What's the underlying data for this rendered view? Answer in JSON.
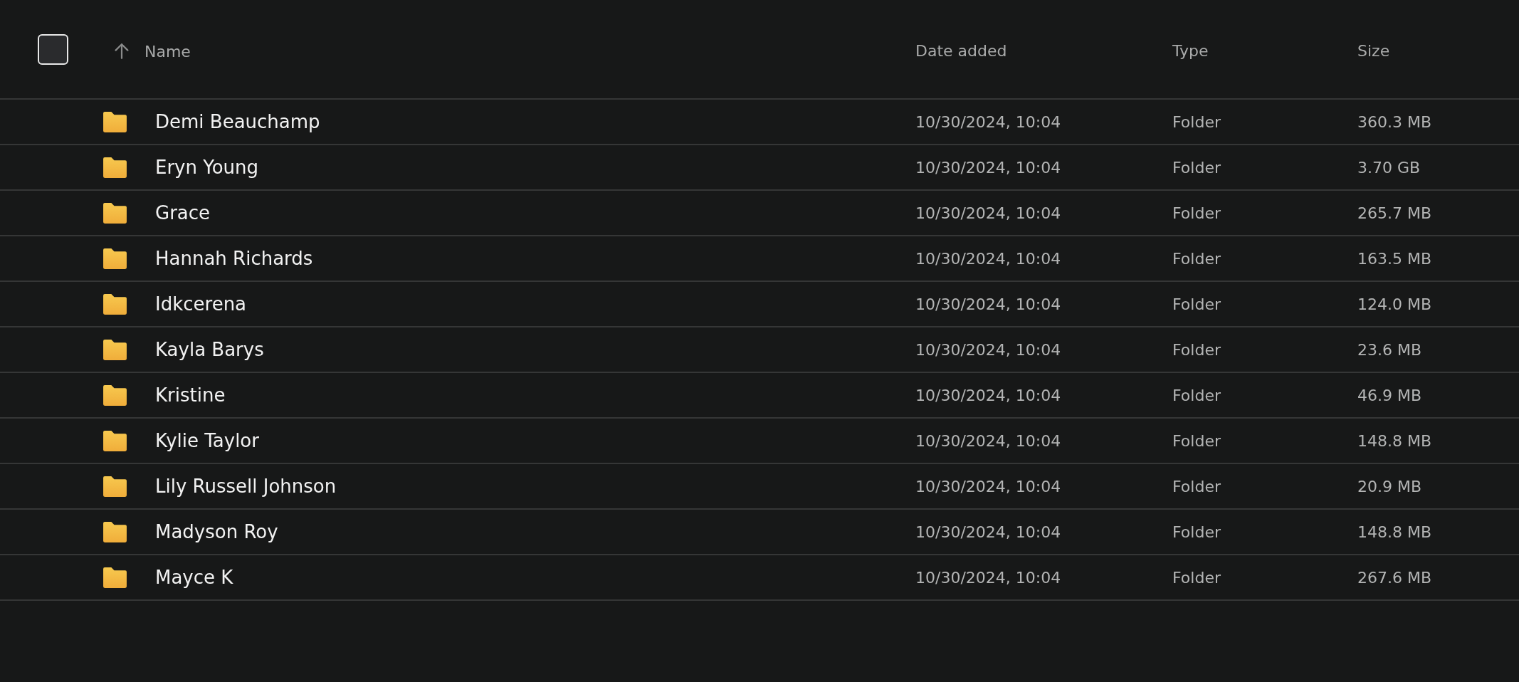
{
  "header": {
    "select_all": {
      "checked": false
    },
    "columns": [
      {
        "label": "Name",
        "sorted": true
      },
      {
        "label": "Date added",
        "sorted": false
      },
      {
        "label": "Type",
        "sorted": false
      },
      {
        "label": "Size",
        "sorted": false
      }
    ]
  },
  "rows": [
    {
      "name": "Demi Beauchamp",
      "date_added": "10/30/2024, 10:04",
      "type": "Folder",
      "size": "360.3 MB"
    },
    {
      "name": "Eryn Young",
      "date_added": "10/30/2024, 10:04",
      "type": "Folder",
      "size": "3.70 GB"
    },
    {
      "name": "Grace",
      "date_added": "10/30/2024, 10:04",
      "type": "Folder",
      "size": "265.7 MB"
    },
    {
      "name": "Hannah Richards",
      "date_added": "10/30/2024, 10:04",
      "type": "Folder",
      "size": "163.5 MB"
    },
    {
      "name": "Idkcerena",
      "date_added": "10/30/2024, 10:04",
      "type": "Folder",
      "size": "124.0 MB"
    },
    {
      "name": "Kayla Barys",
      "date_added": "10/30/2024, 10:04",
      "type": "Folder",
      "size": "23.6 MB"
    },
    {
      "name": "Kristine",
      "date_added": "10/30/2024, 10:04",
      "type": "Folder",
      "size": "46.9 MB"
    },
    {
      "name": "Kylie Taylor",
      "date_added": "10/30/2024, 10:04",
      "type": "Folder",
      "size": "148.8 MB"
    },
    {
      "name": "Lily Russell Johnson",
      "date_added": "10/30/2024, 10:04",
      "type": "Folder",
      "size": "20.9 MB"
    },
    {
      "name": "Madyson Roy",
      "date_added": "10/30/2024, 10:04",
      "type": "Folder",
      "size": "148.8 MB"
    },
    {
      "name": "Mayce K",
      "date_added": "10/30/2024, 10:04",
      "type": "Folder",
      "size": "267.6 MB"
    }
  ]
}
